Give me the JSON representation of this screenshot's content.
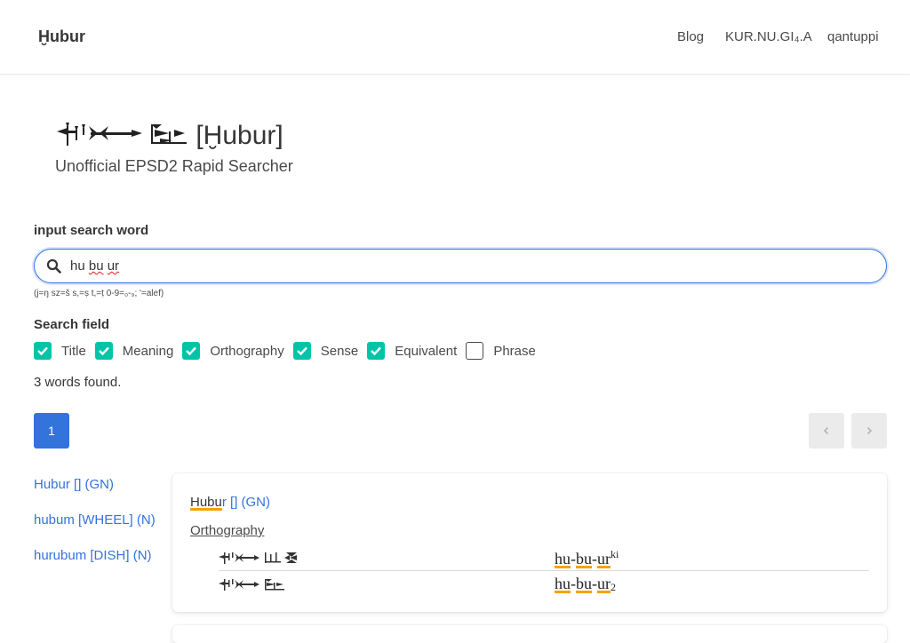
{
  "navbar": {
    "brand": "Ḫubur",
    "links": [
      "Blog",
      "KUR.NU.GI₄.A",
      "qantuppi"
    ]
  },
  "hero": {
    "title_text": "[Ḫubur]",
    "subtitle": "Unofficial EPSD2 Rapid Searcher"
  },
  "search": {
    "label": "input search word",
    "value": "hu bu ur",
    "value_parts": [
      "hu ",
      "bu",
      " ",
      "ur"
    ],
    "hint": "(j=ŋ sz=š s,=ṣ t,=ṭ 0-9=₀-₉; '=alef)"
  },
  "search_field": {
    "label": "Search field",
    "options": [
      {
        "label": "Title",
        "checked": true
      },
      {
        "label": "Meaning",
        "checked": true
      },
      {
        "label": "Orthography",
        "checked": true
      },
      {
        "label": "Sense",
        "checked": true
      },
      {
        "label": "Equivalent",
        "checked": true
      },
      {
        "label": "Phrase",
        "checked": false
      }
    ]
  },
  "status": "3 words found.",
  "pagination": {
    "current_page": "1"
  },
  "results": [
    "Hubur [] (GN)",
    "hubum [WHEEL] (N)",
    "hurubum [DISH] (N)"
  ],
  "detail": {
    "title_highlight": "Hubu",
    "title_rest": "r [] (GN)",
    "orthography_label": "Orthography",
    "rows": [
      {
        "syllables": [
          "hu",
          "bu",
          "ur"
        ],
        "sup": "ki",
        "sub": ""
      },
      {
        "syllables": [
          "hu",
          "bu",
          "ur"
        ],
        "sup": "",
        "sub": "2"
      }
    ]
  },
  "colors": {
    "link": "#3273dc",
    "check": "#00c4a7",
    "highlight": "#f5a200"
  }
}
